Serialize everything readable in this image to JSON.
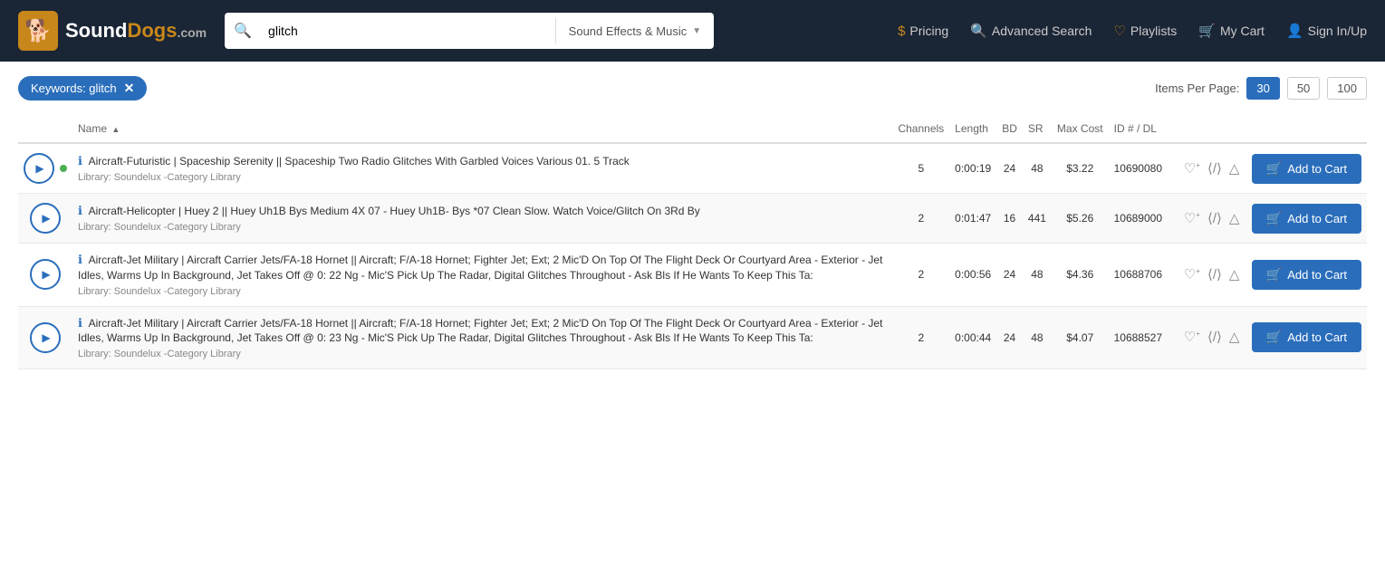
{
  "header": {
    "logo_text": "SoundDogs",
    "logo_domain": ".com",
    "search_value": "glitch",
    "search_placeholder": "glitch",
    "search_category": "Sound Effects & Music",
    "nav": [
      {
        "id": "pricing",
        "icon": "$",
        "label": "Pricing"
      },
      {
        "id": "advanced-search",
        "icon": "🔍",
        "label": "Advanced Search"
      },
      {
        "id": "playlists",
        "icon": "♡",
        "label": "Playlists"
      },
      {
        "id": "my-cart",
        "icon": "🛒",
        "label": "My Cart"
      },
      {
        "id": "sign-in",
        "icon": "👤",
        "label": "Sign In/Up"
      }
    ]
  },
  "filter": {
    "keyword_tag": "Keywords: glitch",
    "items_per_page_label": "Items Per Page:",
    "per_page_options": [
      {
        "value": "30",
        "active": true
      },
      {
        "value": "50",
        "active": false
      },
      {
        "value": "100",
        "active": false
      }
    ]
  },
  "table": {
    "columns": [
      {
        "id": "play",
        "label": ""
      },
      {
        "id": "name",
        "label": "Name",
        "sortable": true,
        "sort_direction": "asc"
      },
      {
        "id": "channels",
        "label": "Channels"
      },
      {
        "id": "length",
        "label": "Length"
      },
      {
        "id": "bd",
        "label": "BD"
      },
      {
        "id": "sr",
        "label": "SR"
      },
      {
        "id": "maxcost",
        "label": "Max Cost"
      },
      {
        "id": "id",
        "label": "ID # / DL"
      },
      {
        "id": "actions",
        "label": ""
      }
    ],
    "rows": [
      {
        "id": 1,
        "playing": true,
        "has_green_dot": true,
        "name": "Aircraft-Futuristic | Spaceship Serenity || Spaceship Two Radio Glitches With Garbled Voices Various 01. 5 Track",
        "library": "Library: Soundelux -Category Library",
        "channels": "5",
        "length": "0:00:19",
        "bd": "24",
        "sr": "48",
        "max_cost": "$3.22",
        "id_num": "10690080",
        "add_to_cart": "Add to Cart"
      },
      {
        "id": 2,
        "playing": false,
        "has_green_dot": false,
        "name": "Aircraft-Helicopter | Huey 2 || Huey Uh1B Bys Medium 4X 07 - Huey Uh1B- Bys *07 Clean Slow. Watch Voice/Glitch On 3Rd By",
        "library": "Library: Soundelux -Category Library",
        "channels": "2",
        "length": "0:01:47",
        "bd": "16",
        "sr": "441",
        "max_cost": "$5.26",
        "id_num": "10689000",
        "add_to_cart": "Add to Cart"
      },
      {
        "id": 3,
        "playing": false,
        "has_green_dot": false,
        "name": "Aircraft-Jet Military | Aircraft Carrier Jets/FA-18 Hornet || Aircraft; F/A-18 Hornet; Fighter Jet; Ext; 2 Mic'D On Top Of The Flight Deck Or Courtyard Area - Exterior - Jet Idles, Warms Up In Background, Jet Takes Off @ 0: 22 Ng - Mic'S Pick Up The Radar, Digital Glitches Throughout - Ask Bls If He Wants To Keep This Ta:",
        "library": "Library: Soundelux -Category Library",
        "channels": "2",
        "length": "0:00:56",
        "bd": "24",
        "sr": "48",
        "max_cost": "$4.36",
        "id_num": "10688706",
        "add_to_cart": "Add to Cart"
      },
      {
        "id": 4,
        "playing": false,
        "has_green_dot": false,
        "name": "Aircraft-Jet Military | Aircraft Carrier Jets/FA-18 Hornet || Aircraft; F/A-18 Hornet; Fighter Jet; Ext; 2 Mic'D On Top Of The Flight Deck Or Courtyard Area - Exterior - Jet Idles, Warms Up In Background, Jet Takes Off @ 0: 23 Ng - Mic'S Pick Up The Radar, Digital Glitches Throughout - Ask Bls If He Wants To Keep This Ta:",
        "library": "Library: Soundelux -Category Library",
        "channels": "2",
        "length": "0:00:44",
        "bd": "24",
        "sr": "48",
        "max_cost": "$4.07",
        "id_num": "10688527",
        "add_to_cart": "Add to Cart"
      }
    ]
  }
}
